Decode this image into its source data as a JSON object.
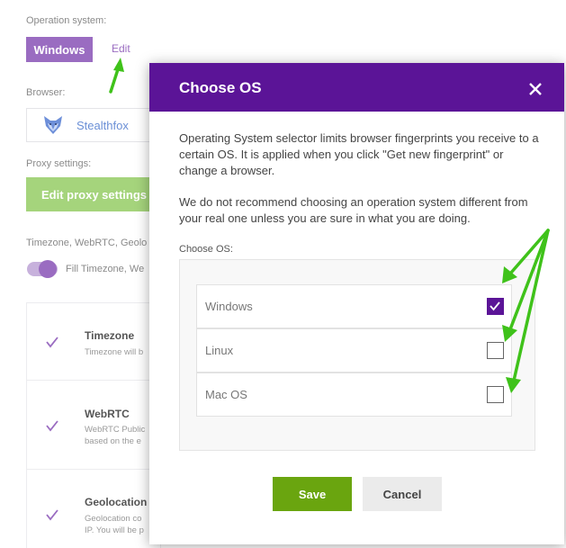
{
  "background": {
    "os_label": "Operation system:",
    "os_value": "Windows",
    "edit_link": "Edit",
    "browser_label": "Browser:",
    "browser_name": "Stealthfox",
    "proxy_label": "Proxy settings:",
    "proxy_button": "Edit proxy settings",
    "timezone_label": "Timezone, WebRTC, Geolo",
    "fill_toggle_text": "Fill Timezone, We",
    "cards": [
      {
        "title": "Timezone",
        "desc": [
          "Timezone will b"
        ]
      },
      {
        "title": "WebRTC",
        "desc": [
          "WebRTC Public",
          "based on the e"
        ]
      },
      {
        "title": "Geolocation",
        "desc": [
          "Geolocation co",
          "IP. You will be p"
        ]
      }
    ]
  },
  "modal": {
    "title": "Choose OS",
    "paragraph1": "Operating System selector limits browser fingerprints you receive to a certain OS. It is applied when you click \"Get new fingerprint\" or change a browser.",
    "paragraph2": "We do not recommend choosing an operation system different from your real one unless you are sure in what you are doing.",
    "choose_label": "Choose OS:",
    "options": [
      {
        "label": "Windows",
        "checked": true
      },
      {
        "label": "Linux",
        "checked": false
      },
      {
        "label": "Mac OS",
        "checked": false
      }
    ],
    "save_label": "Save",
    "cancel_label": "Cancel"
  },
  "colors": {
    "header_purple": "#5b1497",
    "accent_purple": "#9a6cc1",
    "save_green": "#6aa50f",
    "proxy_green": "#a5d47c",
    "annotation_arrow_green": "#3fc21a"
  },
  "icons": [
    "fox-icon",
    "check-icon",
    "close-icon",
    "checkbox-checked-icon",
    "checkbox-empty-icon",
    "arrow-annotation"
  ]
}
